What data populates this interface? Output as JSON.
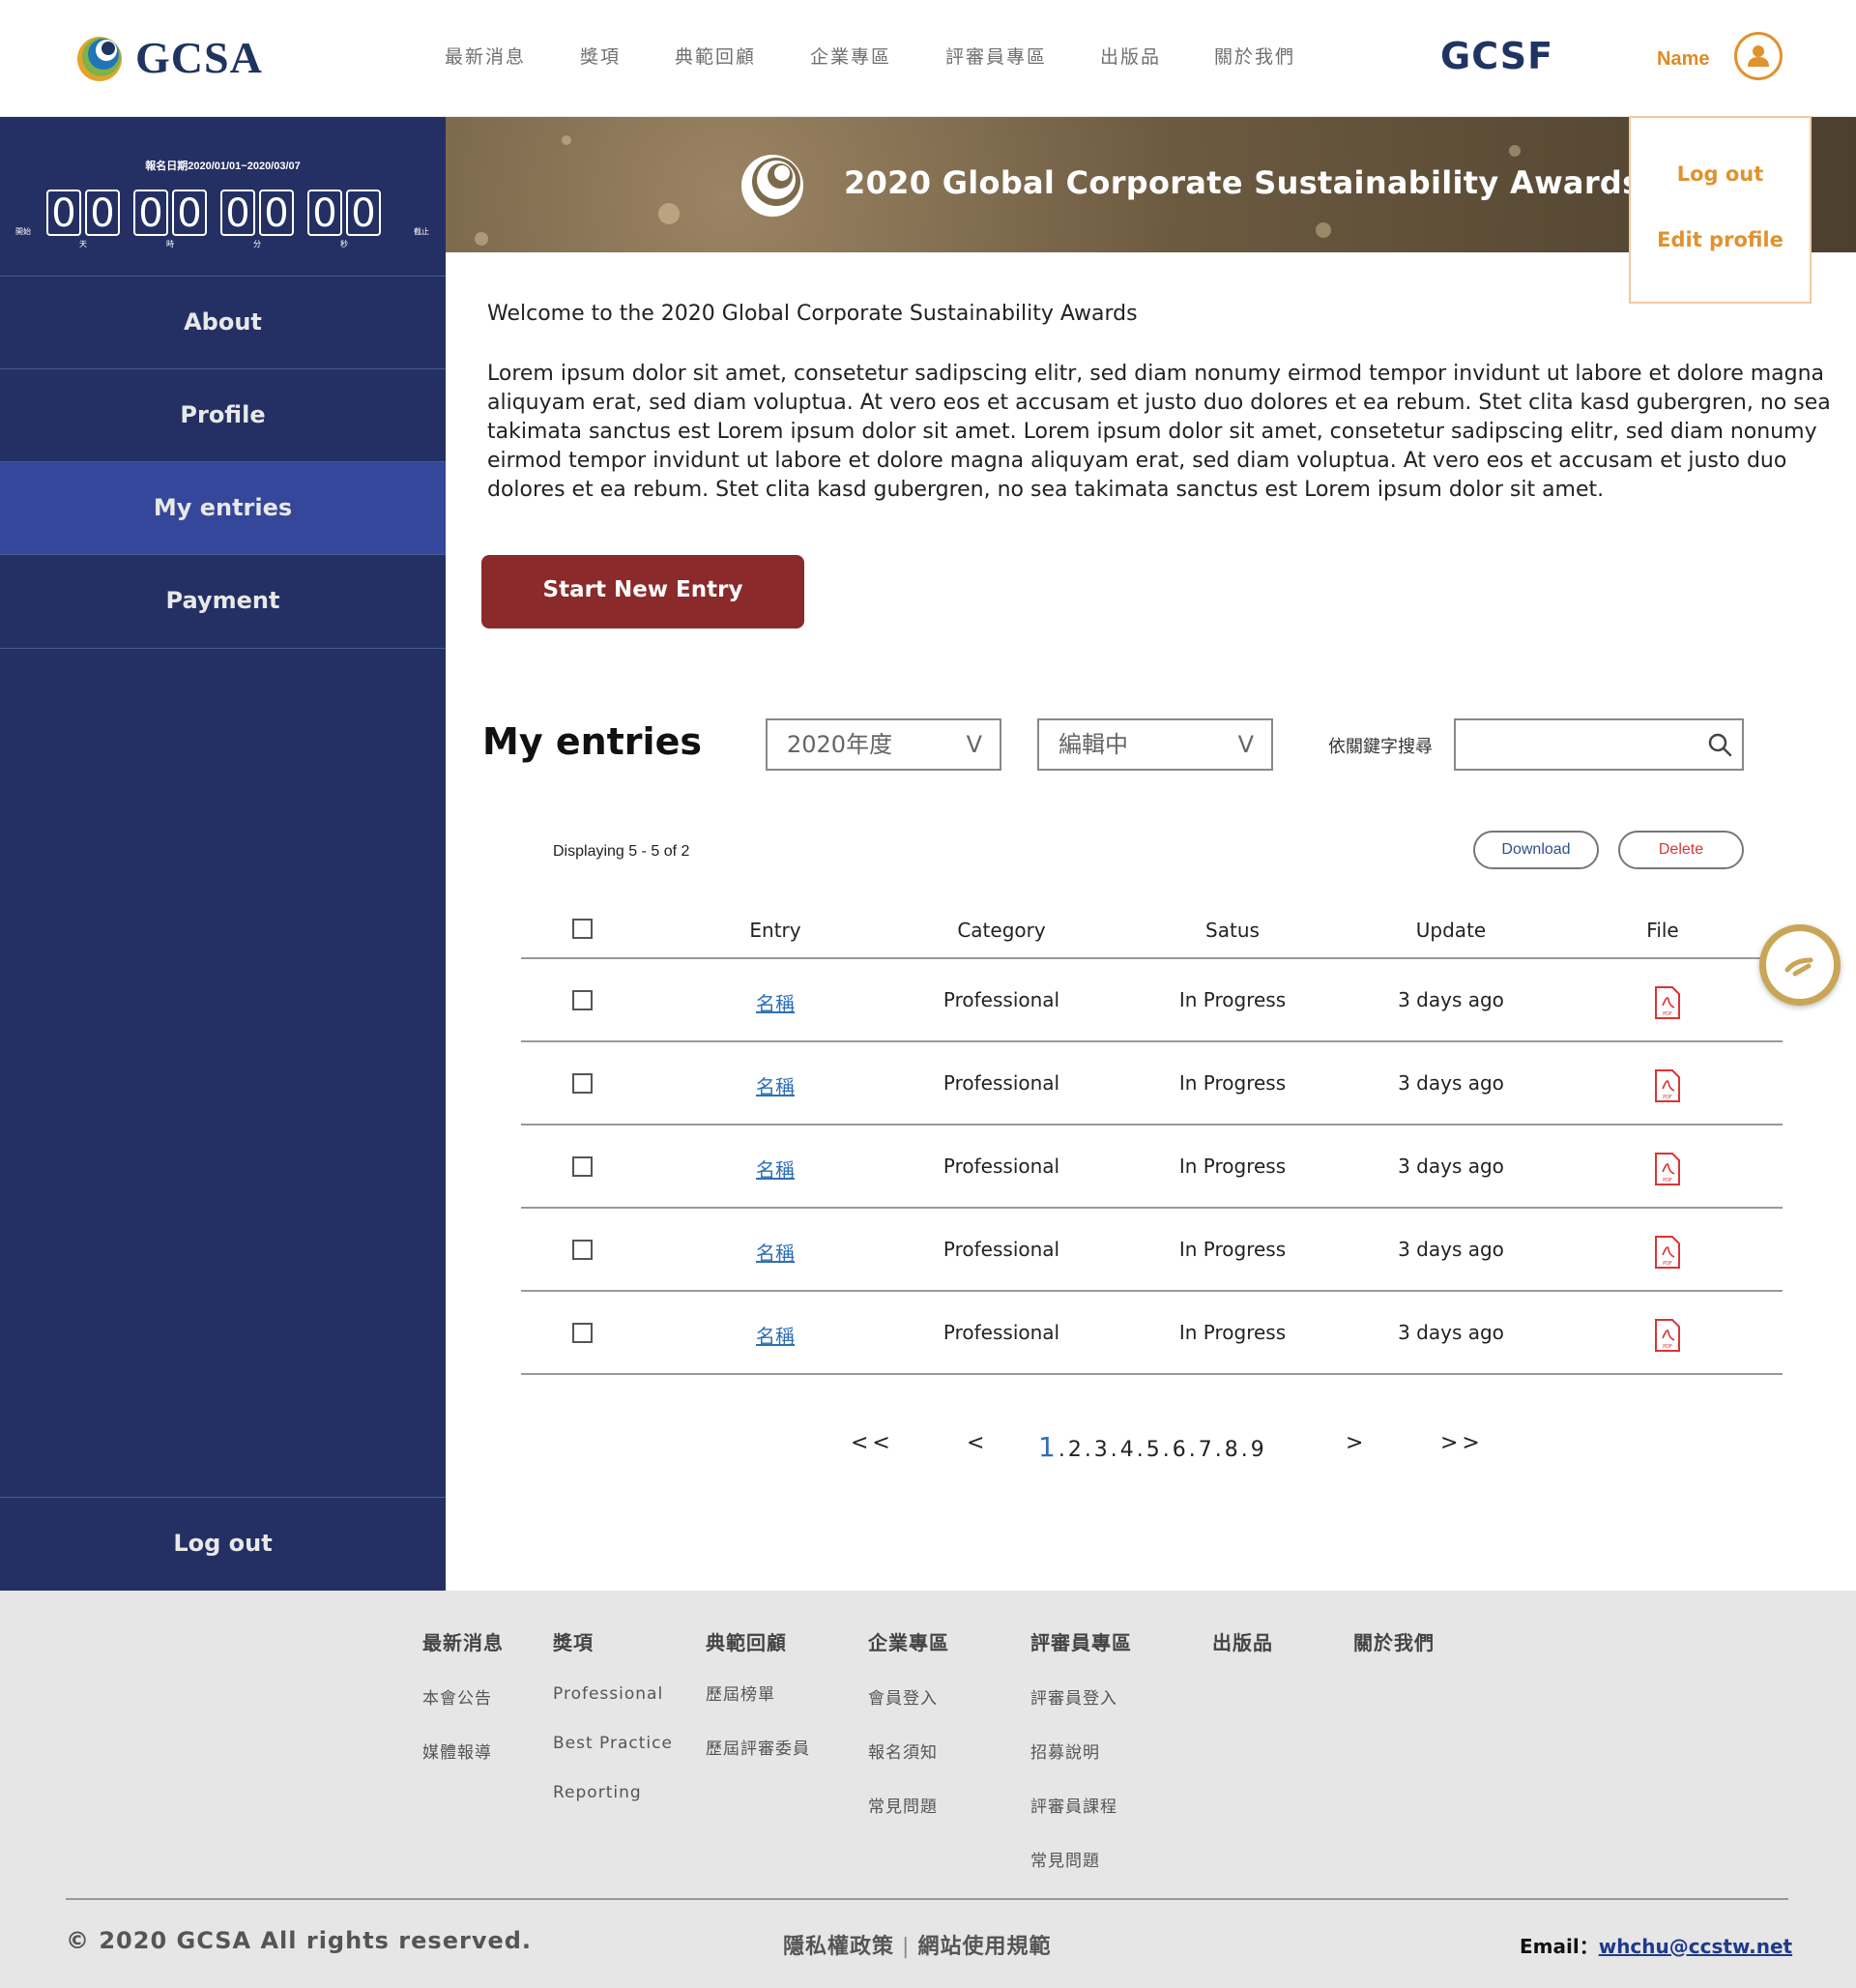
{
  "header": {
    "logo_text": "GCSA",
    "nav": [
      "最新消息",
      "獎項",
      "典範回顧",
      "企業專區",
      "評審員專區",
      "出版品",
      "關於我們"
    ],
    "brand_right": "GCSF",
    "user_name": "Name",
    "accent_color": "#e0922e"
  },
  "user_menu": {
    "logout": "Log out",
    "edit_profile": "Edit profile"
  },
  "sidebar": {
    "countdown": {
      "date_range": "報名日期2020/01/01~2020/03/07",
      "start_label": "開始",
      "end_label": "截止",
      "groups": [
        {
          "digits": [
            "0",
            "0"
          ],
          "unit": "天"
        },
        {
          "digits": [
            "0",
            "0"
          ],
          "unit": "時"
        },
        {
          "digits": [
            "0",
            "0"
          ],
          "unit": "分"
        },
        {
          "digits": [
            "0",
            "0"
          ],
          "unit": "秒"
        }
      ]
    },
    "items": [
      "About",
      "Profile",
      "My entries",
      "Payment"
    ],
    "active": "My entries",
    "logout": "Log out",
    "bg_color": "#243063",
    "active_color": "#34479a"
  },
  "banner": {
    "title": "2020 Global Corporate Sustainability Awards"
  },
  "main": {
    "welcome": "Welcome to the 2020 Global Corporate Sustainability Awards",
    "intro": "Lorem ipsum dolor sit amet, consetetur sadipscing elitr, sed diam nonumy eirmod tempor invidunt ut labore et dolore magna aliquyam erat, sed diam voluptua. At vero eos et accusam et justo duo dolores et ea rebum. Stet clita kasd gubergren, no sea takimata sanctus est Lorem ipsum dolor sit amet. Lorem ipsum dolor sit amet, consetetur sadipscing elitr, sed diam nonumy eirmod tempor invidunt ut labore et dolore magna aliquyam erat, sed diam voluptua. At vero eos et accusam et justo duo dolores et ea rebum. Stet clita kasd gubergren, no sea takimata sanctus est Lorem ipsum dolor sit amet.",
    "start_button": "Start New Entry",
    "start_button_color": "#8b2a2a"
  },
  "entries": {
    "title": "My entries",
    "year_select": "2020年度",
    "status_select": "編輯中",
    "select_chevron": "V",
    "search_label": "依關鍵字搜尋",
    "search_value": "",
    "displaying": "Displaying 5 - 5 of 2",
    "download": "Download",
    "delete": "Delete",
    "columns": [
      "Entry",
      "Category",
      "Satus",
      "Update",
      "File"
    ],
    "rows": [
      {
        "entry": "名稱",
        "category": "Professional",
        "status": "In Progress",
        "update": "3 days ago",
        "file": "PDF"
      },
      {
        "entry": "名稱",
        "category": "Professional",
        "status": "In Progress",
        "update": "3 days ago",
        "file": "PDF"
      },
      {
        "entry": "名稱",
        "category": "Professional",
        "status": "In Progress",
        "update": "3 days ago",
        "file": "PDF"
      },
      {
        "entry": "名稱",
        "category": "Professional",
        "status": "In Progress",
        "update": "3 days ago",
        "file": "PDF"
      },
      {
        "entry": "名稱",
        "category": "Professional",
        "status": "In Progress",
        "update": "3 days ago",
        "file": "PDF"
      }
    ],
    "pagination": {
      "first": "<<",
      "prev": "<",
      "current": "1",
      "pages": ".2.3.4.5.6.7.8.9",
      "next": ">",
      "last": ">>"
    }
  },
  "footer": {
    "columns": [
      {
        "title": "最新消息",
        "links": [
          "本會公告",
          "媒體報導"
        ]
      },
      {
        "title": "獎項",
        "links": [
          "Professional",
          "Best Practice",
          "Reporting"
        ]
      },
      {
        "title": "典範回顧",
        "links": [
          "歷屆榜單",
          "歷屆評審委員"
        ]
      },
      {
        "title": "企業專區",
        "links": [
          "會員登入",
          "報名須知",
          "常見問題"
        ]
      },
      {
        "title": "評審員專區",
        "links": [
          "評審員登入",
          "招募說明",
          "評審員課程",
          "常見問題"
        ]
      },
      {
        "title": "出版品",
        "links": []
      },
      {
        "title": "關於我們",
        "links": []
      }
    ],
    "copyright": "© 2020 GCSA All rights reserved.",
    "privacy": "隱私權政策",
    "separator": "|",
    "terms": "網站使用規範",
    "email_label": "Email：",
    "email": "whchu@ccstw.net"
  }
}
